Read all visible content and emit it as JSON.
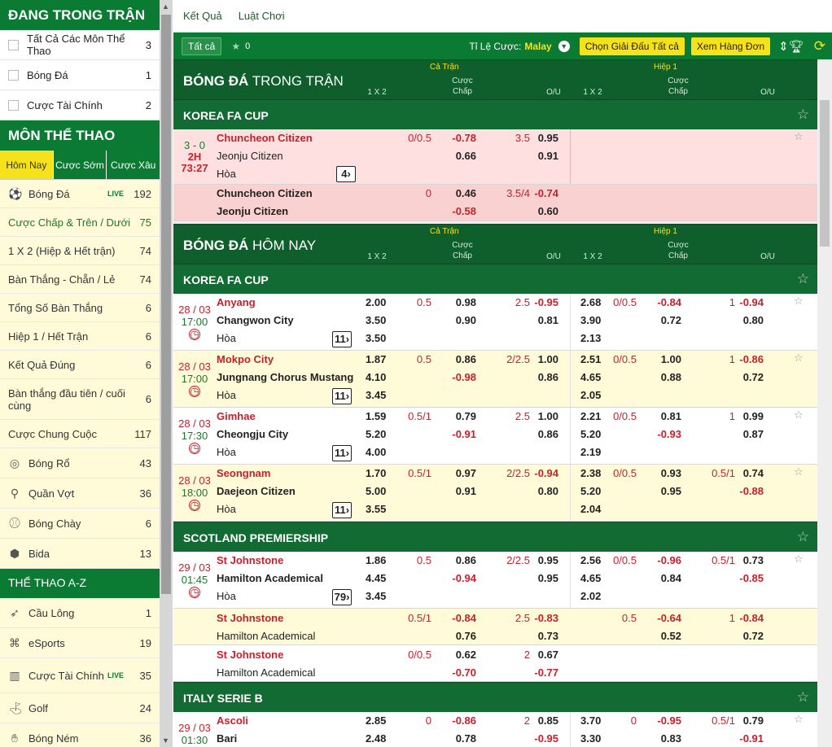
{
  "sidebar": {
    "live_title": "ĐANG TRONG TRẬN",
    "live_items": [
      {
        "label": "Tất Cả Các Môn Thể Thao",
        "count": "3"
      },
      {
        "label": "Bóng Đá",
        "count": "1"
      },
      {
        "label": "Cược Tài Chính",
        "count": "2"
      }
    ],
    "sports_title": "MÔN THỂ THAO",
    "tabs": [
      "Hôm Nay",
      "Cược Sớm",
      "Cược Xâu"
    ],
    "football": {
      "label": "Bóng Đá",
      "live": "LIVE",
      "count": "192"
    },
    "markets": [
      {
        "label": "Cược Chấp & Trên / Dưới",
        "count": "75"
      },
      {
        "label": "1 X 2 (Hiệp & Hết trận)",
        "count": "74"
      },
      {
        "label": "Bàn Thắng - Chẵn / Lẻ",
        "count": "74"
      },
      {
        "label": "Tổng Số Bàn Thắng",
        "count": "6"
      },
      {
        "label": "Hiệp 1 / Hết Trận",
        "count": "6"
      },
      {
        "label": "Kết Quả Đúng",
        "count": "6"
      },
      {
        "label": "Bàn thắng đầu tiên / cuối cùng",
        "count": "6"
      },
      {
        "label": "Cược Chung Cuộc",
        "count": "117"
      }
    ],
    "other_sports": [
      {
        "label": "Bóng Rổ",
        "count": "43",
        "icon": "basketball-icon"
      },
      {
        "label": "Quần Vợt",
        "count": "36",
        "icon": "tennis-icon"
      },
      {
        "label": "Bóng Chày",
        "count": "6",
        "icon": "baseball-icon"
      },
      {
        "label": "Bida",
        "count": "13",
        "icon": "billiards-icon"
      }
    ],
    "az_title": "THỂ THAO A-Z",
    "az_sports": [
      {
        "label": "Cầu Lông",
        "count": "1",
        "icon": "badminton-icon"
      },
      {
        "label": "eSports",
        "count": "19",
        "icon": "esports-icon"
      },
      {
        "label": "Cược Tài Chính",
        "count": "35",
        "live": "LIVE",
        "icon": "financial-icon"
      },
      {
        "label": "Golf",
        "count": "24",
        "icon": "golf-icon"
      },
      {
        "label": "Bóng Ném",
        "count": "36",
        "icon": "handball-icon"
      }
    ]
  },
  "nav": {
    "results": "Kết Quả",
    "rules": "Luật Chơi"
  },
  "toolbar": {
    "all": "Tất cả",
    "fav_count": "0",
    "odds_label": "Tỉ Lệ Cược:",
    "odds_value": "Malay",
    "choose_league": "Chọn Giải Đấu  Tất cả",
    "view_slip": "Xem Hàng Đơn"
  },
  "colhead": {
    "ft": "Cả Trận",
    "h1": "Hiệp 1",
    "x12": "1 X 2",
    "hdp1": "Cược",
    "hdp2": "Chấp",
    "ou": "O/U"
  },
  "live_section": {
    "title_bold": "BÓNG ĐÁ",
    "title_rest": " TRONG TRẬN",
    "league": "KOREA FA CUP",
    "match": {
      "score": "3 - 0",
      "period": "2H",
      "time": "73:27",
      "home": "Chuncheon Citizen",
      "away": "Jeonju Citizen",
      "draw": "Hòa",
      "badge": "4",
      "hdp_line": "0/0.5",
      "hdp_home": "-0.78",
      "hdp_away": "0.66",
      "ou_line": "3.5",
      "ou_over": "0.95",
      "ou_under": "0.91"
    },
    "sub": {
      "home": "Chuncheon Citizen",
      "away": "Jeonju Citizen",
      "hdp_line": "0",
      "hdp_home": "0.46",
      "hdp_away": "-0.58",
      "ou_line": "3.5/4",
      "ou_over": "-0.74",
      "ou_under": "0.60"
    }
  },
  "today_section": {
    "title_bold": "BÓNG ĐÁ",
    "title_rest": " HÔM NAY",
    "leagues": [
      {
        "name": "KOREA FA CUP",
        "matches": [
          {
            "date": "28 / 03",
            "time": "17:00",
            "home": "Anyang",
            "away": "Changwon City",
            "draw": "Hòa",
            "badge": "11",
            "x1": "2.00",
            "x2": "3.50",
            "xd": "3.50",
            "hl": "0.5",
            "hh": "0.98",
            "ha": "0.90",
            "ol": "2.5",
            "oo": "-0.95",
            "ou": "0.81",
            "h1x1": "2.68",
            "h1x2": "3.90",
            "h1xd": "2.13",
            "h1hl": "0/0.5",
            "h1hh": "-0.84",
            "h1ha": "0.72",
            "h1ol": "1",
            "h1oo": "-0.94",
            "h1ou": "0.80"
          },
          {
            "date": "28 / 03",
            "time": "17:00",
            "home": "Mokpo City",
            "away": "Jungnang Chorus Mustang",
            "draw": "Hòa",
            "badge": "11",
            "x1": "1.87",
            "x2": "4.10",
            "xd": "3.45",
            "hl": "0.5",
            "hh": "0.86",
            "ha": "-0.98",
            "ol": "2/2.5",
            "oo": "1.00",
            "ou": "0.86",
            "h1x1": "2.51",
            "h1x2": "4.65",
            "h1xd": "2.05",
            "h1hl": "0/0.5",
            "h1hh": "1.00",
            "h1ha": "0.88",
            "h1ol": "1",
            "h1oo": "-0.86",
            "h1ou": "0.72"
          },
          {
            "date": "28 / 03",
            "time": "17:30",
            "home": "Gimhae",
            "away": "Cheongju City",
            "draw": "Hòa",
            "badge": "11",
            "x1": "1.59",
            "x2": "5.20",
            "xd": "4.00",
            "hl": "0.5/1",
            "hh": "0.79",
            "ha": "-0.91",
            "ol": "2.5",
            "oo": "1.00",
            "ou": "0.86",
            "h1x1": "2.21",
            "h1x2": "5.20",
            "h1xd": "2.19",
            "h1hl": "0/0.5",
            "h1hh": "0.81",
            "h1ha": "-0.93",
            "h1ol": "1",
            "h1oo": "0.99",
            "h1ou": "0.87"
          },
          {
            "date": "28 / 03",
            "time": "18:00",
            "home": "Seongnam",
            "away": "Daejeon Citizen",
            "draw": "Hòa",
            "badge": "11",
            "x1": "1.70",
            "x2": "5.00",
            "xd": "3.55",
            "hl": "0.5/1",
            "hh": "0.97",
            "ha": "0.91",
            "ol": "2/2.5",
            "oo": "-0.94",
            "ou": "0.80",
            "h1x1": "2.38",
            "h1x2": "5.20",
            "h1xd": "2.04",
            "h1hl": "0/0.5",
            "h1hh": "0.93",
            "h1ha": "0.95",
            "h1ol": "0.5/1",
            "h1oo": "0.74",
            "h1ou": "-0.88"
          }
        ]
      },
      {
        "name": "SCOTLAND PREMIERSHIP",
        "matches": [
          {
            "date": "29 / 03",
            "time": "01:45",
            "home": "St Johnstone",
            "away": "Hamilton Academical",
            "draw": "Hòa",
            "badge": "79",
            "x1": "1.86",
            "x2": "4.45",
            "xd": "3.45",
            "hl": "0.5",
            "hh": "0.86",
            "ha": "-0.94",
            "ol": "2/2.5",
            "oo": "0.95",
            "ou": "0.95",
            "h1x1": "2.56",
            "h1x2": "4.65",
            "h1xd": "2.02",
            "h1hl": "0/0.5",
            "h1hh": "-0.96",
            "h1ha": "0.84",
            "h1ol": "0.5/1",
            "h1oo": "0.73",
            "h1ou": "-0.85"
          }
        ],
        "subs": [
          {
            "home": "St Johnstone",
            "away": "Hamilton Academical",
            "hl": "0.5/1",
            "hh": "-0.84",
            "ha": "0.76",
            "ol": "2.5",
            "oo": "-0.83",
            "ou": "0.73",
            "h1hl": "0.5",
            "h1hh": "-0.64",
            "h1ha": "0.52",
            "h1ol": "1",
            "h1oo": "-0.84",
            "h1ou": "0.72"
          },
          {
            "home": "St Johnstone",
            "away": "Hamilton Academical",
            "hl": "0/0.5",
            "hh": "0.62",
            "ha": "-0.70",
            "ol": "2",
            "oo": "0.67",
            "ou": "-0.77"
          }
        ]
      },
      {
        "name": "ITALY SERIE B",
        "matches": [
          {
            "date": "29 / 03",
            "time": "01:30",
            "home": "Ascoli",
            "away": "Bari",
            "x1": "2.85",
            "x2": "2.48",
            "hl": "0",
            "hh": "-0.86",
            "ha": "0.78",
            "ol": "2",
            "oo": "0.85",
            "ou": "-0.95",
            "h1x1": "3.70",
            "h1x2": "3.30",
            "h1hl": "0",
            "h1hh": "-0.95",
            "h1ha": "0.83",
            "h1ol": "0.5/1",
            "h1oo": "0.79",
            "h1ou": "-0.91"
          }
        ]
      }
    ]
  }
}
